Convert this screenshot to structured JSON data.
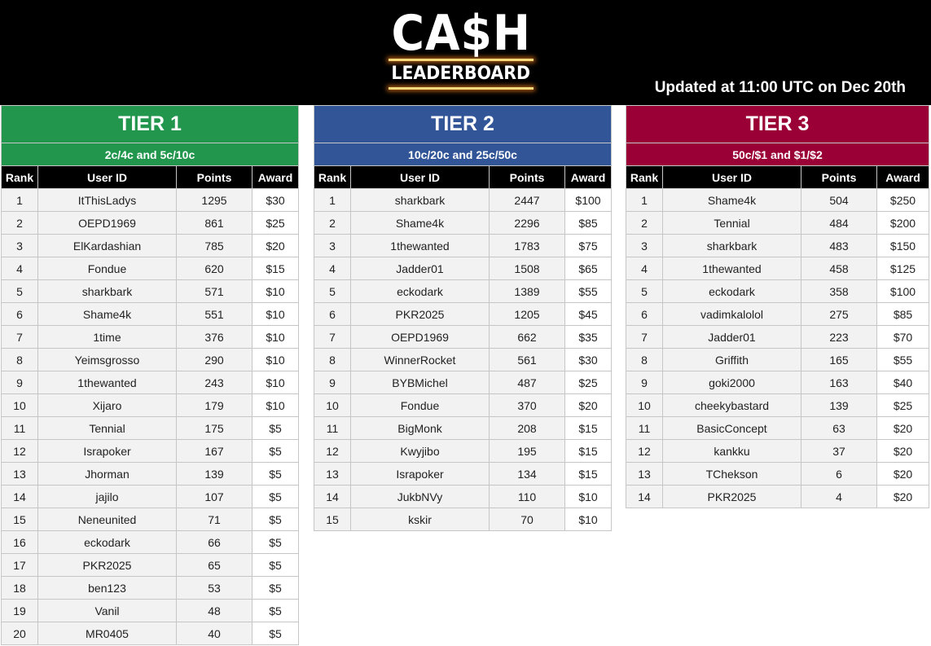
{
  "header": {
    "logo_main": "CA$H",
    "logo_sub": "LEADERBOARD",
    "updated": "Updated at 11:00 UTC on Dec 20th"
  },
  "columns": [
    "Rank",
    "User ID",
    "Points",
    "Award"
  ],
  "tiers": [
    {
      "title": "TIER 1",
      "stakes": "2c/4c and 5c/10c",
      "color": "#22964d",
      "rows": [
        {
          "rank": "1",
          "user": "ItThisLadys",
          "points": "1295",
          "award": "$30"
        },
        {
          "rank": "2",
          "user": "OEPD1969",
          "points": "861",
          "award": "$25"
        },
        {
          "rank": "3",
          "user": "ElKardashian",
          "points": "785",
          "award": "$20"
        },
        {
          "rank": "4",
          "user": "Fondue",
          "points": "620",
          "award": "$15"
        },
        {
          "rank": "5",
          "user": "sharkbark",
          "points": "571",
          "award": "$10"
        },
        {
          "rank": "6",
          "user": "Shame4k",
          "points": "551",
          "award": "$10"
        },
        {
          "rank": "7",
          "user": "1time",
          "points": "376",
          "award": "$10"
        },
        {
          "rank": "8",
          "user": "Yeimsgrosso",
          "points": "290",
          "award": "$10"
        },
        {
          "rank": "9",
          "user": "1thewanted",
          "points": "243",
          "award": "$10"
        },
        {
          "rank": "10",
          "user": "Xijaro",
          "points": "179",
          "award": "$10"
        },
        {
          "rank": "11",
          "user": "Tennial",
          "points": "175",
          "award": "$5"
        },
        {
          "rank": "12",
          "user": "Israpoker",
          "points": "167",
          "award": "$5"
        },
        {
          "rank": "13",
          "user": "Jhorman",
          "points": "139",
          "award": "$5"
        },
        {
          "rank": "14",
          "user": "jajilo",
          "points": "107",
          "award": "$5"
        },
        {
          "rank": "15",
          "user": "Neneunited",
          "points": "71",
          "award": "$5"
        },
        {
          "rank": "16",
          "user": "eckodark",
          "points": "66",
          "award": "$5"
        },
        {
          "rank": "17",
          "user": "PKR2025",
          "points": "65",
          "award": "$5"
        },
        {
          "rank": "18",
          "user": "ben123",
          "points": "53",
          "award": "$5"
        },
        {
          "rank": "19",
          "user": "Vanil",
          "points": "48",
          "award": "$5"
        },
        {
          "rank": "20",
          "user": "MR0405",
          "points": "40",
          "award": "$5"
        }
      ]
    },
    {
      "title": "TIER 2",
      "stakes": "10c/20c and 25c/50c",
      "color": "#325597",
      "rows": [
        {
          "rank": "1",
          "user": "sharkbark",
          "points": "2447",
          "award": "$100"
        },
        {
          "rank": "2",
          "user": "Shame4k",
          "points": "2296",
          "award": "$85"
        },
        {
          "rank": "3",
          "user": "1thewanted",
          "points": "1783",
          "award": "$75"
        },
        {
          "rank": "4",
          "user": "Jadder01",
          "points": "1508",
          "award": "$65"
        },
        {
          "rank": "5",
          "user": "eckodark",
          "points": "1389",
          "award": "$55"
        },
        {
          "rank": "6",
          "user": "PKR2025",
          "points": "1205",
          "award": "$45"
        },
        {
          "rank": "7",
          "user": "OEPD1969",
          "points": "662",
          "award": "$35"
        },
        {
          "rank": "8",
          "user": "WinnerRocket",
          "points": "561",
          "award": "$30"
        },
        {
          "rank": "9",
          "user": "BYBMichel",
          "points": "487",
          "award": "$25"
        },
        {
          "rank": "10",
          "user": "Fondue",
          "points": "370",
          "award": "$20"
        },
        {
          "rank": "11",
          "user": "BigMonk",
          "points": "208",
          "award": "$15"
        },
        {
          "rank": "12",
          "user": "Kwyjibo",
          "points": "195",
          "award": "$15"
        },
        {
          "rank": "13",
          "user": "Israpoker",
          "points": "134",
          "award": "$15"
        },
        {
          "rank": "14",
          "user": "JukbNVy",
          "points": "110",
          "award": "$10"
        },
        {
          "rank": "15",
          "user": "kskir",
          "points": "70",
          "award": "$10"
        }
      ]
    },
    {
      "title": "TIER 3",
      "stakes": "50c/$1 and $1/$2",
      "color": "#9a0035",
      "rows": [
        {
          "rank": "1",
          "user": "Shame4k",
          "points": "504",
          "award": "$250"
        },
        {
          "rank": "2",
          "user": "Tennial",
          "points": "484",
          "award": "$200"
        },
        {
          "rank": "3",
          "user": "sharkbark",
          "points": "483",
          "award": "$150"
        },
        {
          "rank": "4",
          "user": "1thewanted",
          "points": "458",
          "award": "$125"
        },
        {
          "rank": "5",
          "user": "eckodark",
          "points": "358",
          "award": "$100"
        },
        {
          "rank": "6",
          "user": "vadimkalolol",
          "points": "275",
          "award": "$85"
        },
        {
          "rank": "7",
          "user": "Jadder01",
          "points": "223",
          "award": "$70"
        },
        {
          "rank": "8",
          "user": "Griffith",
          "points": "165",
          "award": "$55"
        },
        {
          "rank": "9",
          "user": "goki2000",
          "points": "163",
          "award": "$40"
        },
        {
          "rank": "10",
          "user": "cheekybastard",
          "points": "139",
          "award": "$25"
        },
        {
          "rank": "11",
          "user": "BasicConcept",
          "points": "63",
          "award": "$20"
        },
        {
          "rank": "12",
          "user": "kankku",
          "points": "37",
          "award": "$20"
        },
        {
          "rank": "13",
          "user": "TChekson",
          "points": "6",
          "award": "$20"
        },
        {
          "rank": "14",
          "user": "PKR2025",
          "points": "4",
          "award": "$20"
        }
      ]
    }
  ]
}
